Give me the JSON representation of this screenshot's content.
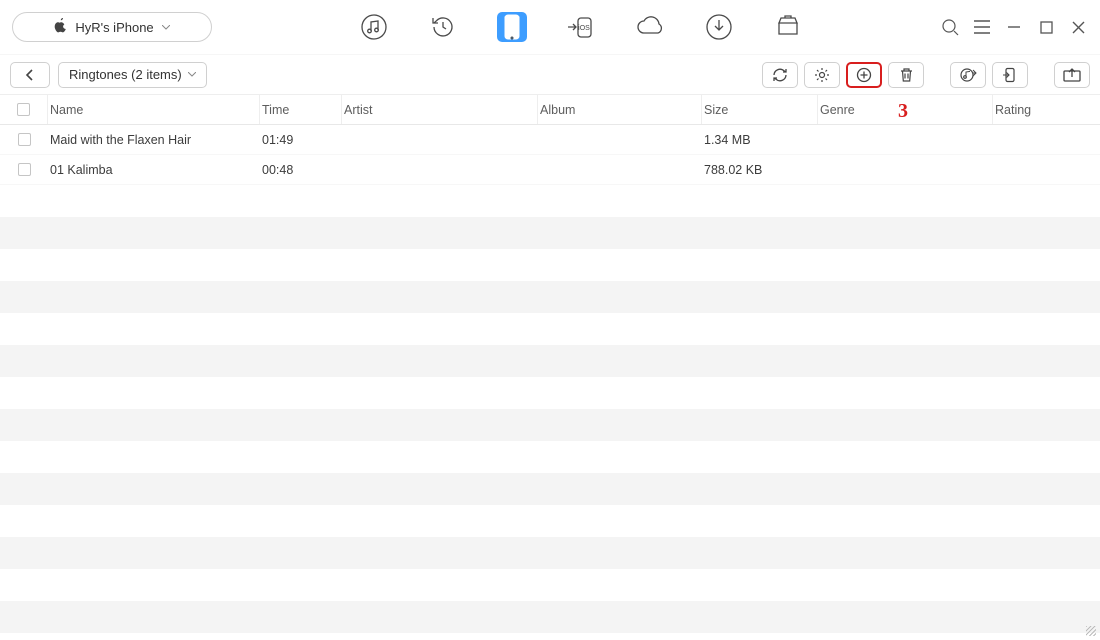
{
  "device": {
    "name": "HyR's iPhone"
  },
  "category_dropdown": "Ringtones (2 items)",
  "nav_icons": [
    "music",
    "history",
    "phone",
    "to-ios",
    "cloud",
    "download",
    "tshirt"
  ],
  "action_icons": [
    "refresh",
    "settings",
    "add",
    "delete",
    "to-itunes",
    "to-device",
    "import"
  ],
  "annotation": "3",
  "columns": {
    "name": "Name",
    "time": "Time",
    "artist": "Artist",
    "album": "Album",
    "size": "Size",
    "genre": "Genre",
    "rating": "Rating"
  },
  "rows": [
    {
      "name": "Maid with the Flaxen Hair",
      "time": "01:49",
      "artist": "",
      "album": "",
      "size": "1.34 MB",
      "genre": "",
      "rating": ""
    },
    {
      "name": "01 Kalimba",
      "time": "00:48",
      "artist": "",
      "album": "",
      "size": "788.02 KB",
      "genre": "",
      "rating": ""
    }
  ]
}
